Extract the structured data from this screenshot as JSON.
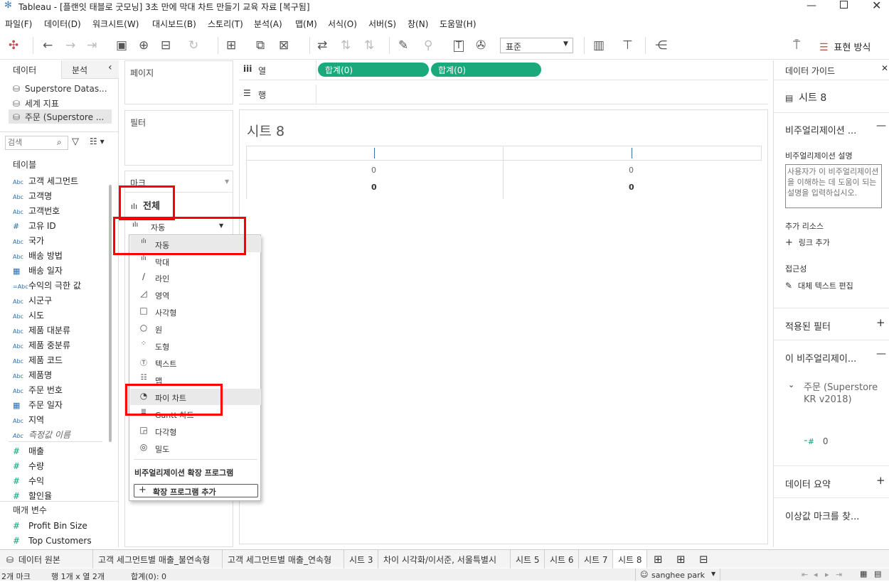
{
  "window": {
    "title": "Tableau - [플랜잇 태블로 굿모닝] 3초 만에 막대 차트 만들기 교육 자료 [복구됨]"
  },
  "menu": [
    "파일(F)",
    "데이터(D)",
    "워크시트(W)",
    "대시보드(B)",
    "스토리(T)",
    "분석(A)",
    "맵(M)",
    "서식(O)",
    "서버(S)",
    "창(N)",
    "도움말(H)"
  ],
  "toolbar": {
    "fit_select": "표준",
    "show_me": "표현 방식"
  },
  "left_panel": {
    "tab_data": "데이터",
    "tab_analysis": "분석",
    "datasources": [
      "Superstore Datas...",
      "세계 지표",
      "주문 (Superstore ..."
    ],
    "search_placeholder": "검색",
    "tables_header": "테이블",
    "dimensions": [
      {
        "type": "Abc",
        "name": "고객 세그먼트"
      },
      {
        "type": "Abc",
        "name": "고객명"
      },
      {
        "type": "Abc",
        "name": "고객번호"
      },
      {
        "type": "#",
        "name": "고유 ID"
      },
      {
        "type": "Abc",
        "name": "국가"
      },
      {
        "type": "Abc",
        "name": "배송 방법"
      },
      {
        "type": "cal",
        "name": "배송 일자"
      },
      {
        "type": "=Abc",
        "name": "수익의 극한 값"
      },
      {
        "type": "Abc",
        "name": "시군구"
      },
      {
        "type": "Abc",
        "name": "시도"
      },
      {
        "type": "Abc",
        "name": "제품 대분류"
      },
      {
        "type": "Abc",
        "name": "제품 중분류"
      },
      {
        "type": "Abc",
        "name": "제품 코드"
      },
      {
        "type": "Abc",
        "name": "제품명"
      },
      {
        "type": "Abc",
        "name": "주문 번호"
      },
      {
        "type": "cal",
        "name": "주문 일자"
      },
      {
        "type": "Abc",
        "name": "지역"
      },
      {
        "type": "Abc",
        "name": "측정값 이름"
      }
    ],
    "measures": [
      "매출",
      "수량",
      "수익",
      "할인율"
    ],
    "params_header": "매개 변수",
    "params": [
      "Profit Bin Size",
      "Top Customers"
    ]
  },
  "shelves": {
    "pages": "페이지",
    "filters": "필터",
    "marks": "마크",
    "marks_all": "전체",
    "mark_type": "자동",
    "columns_label": "열",
    "rows_label": "행",
    "column_pills": [
      "합계(0)",
      "합계(0)"
    ]
  },
  "mark_menu": {
    "items": [
      "자동",
      "막대",
      "라인",
      "영역",
      "사각형",
      "원",
      "도형",
      "텍스트",
      "맵",
      "파이 차트",
      "Gantt 차트",
      "다각형",
      "밀도"
    ],
    "extensions_header": "비주얼리제이션 확장 프로그램",
    "add_extension": "확장 프로그램 추가"
  },
  "viz": {
    "title": "시트 8",
    "cells": [
      {
        "a": "0",
        "b": "0"
      },
      {
        "a": "0",
        "b": "0"
      }
    ]
  },
  "right_panel": {
    "header": "데이터 가이드",
    "sheet": "시트 8",
    "viz_section": "비주얼리제이션 ...",
    "desc_label": "비주얼리제이션 설명",
    "desc_placeholder": "사용자가 이 비주얼리제이션을 이해하는 데 도움이 되는 설명을 입력하십시오.",
    "resources": "추가 리소스",
    "add_link": "링크 추가",
    "accessibility": "접근성",
    "edit_alt": "대체 텍스트 편집",
    "applied_filters": "적용된 필터",
    "this_viz": "이 비주얼리제이...",
    "datasource": "주문 (Superstore KR v2018)",
    "field_value": "0",
    "data_summary": "데이터 요약",
    "outliers": "이상값 마크를 찾..."
  },
  "bottom_tabs": [
    "데이터 원본",
    "고객 세그먼트별 매출_불연속형",
    "고객 세그먼트별 매출_연속형",
    "시트 3",
    "차이 시각화/이서준, 서울특별시",
    "시트 5",
    "시트 6",
    "시트 7",
    "시트 8"
  ],
  "status": {
    "marks": "2개 마크",
    "rows_cols": "행 1개 x 열 2개",
    "sum": "합계(0): 0",
    "user": "sanghee park"
  },
  "colors": {
    "pill": "#1aa97a",
    "highlight_box": "#ff0000"
  }
}
